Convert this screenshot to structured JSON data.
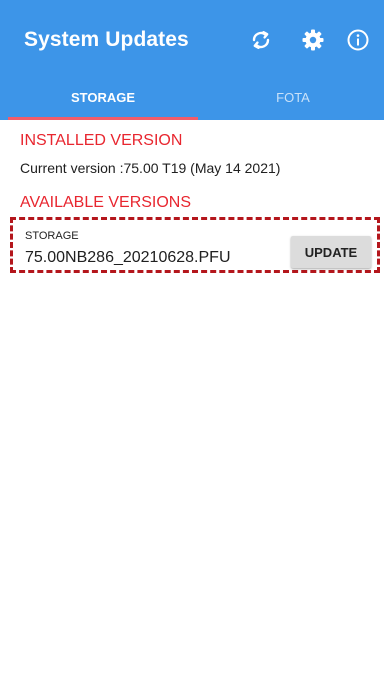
{
  "app": {
    "title": "System Updates",
    "accent_color": "#3d95e8",
    "heading_color": "#e8262f"
  },
  "toolbar": {
    "icons": [
      "sync-icon",
      "gear-icon",
      "info-icon"
    ]
  },
  "tabs": [
    {
      "label": "STORAGE",
      "selected": true
    },
    {
      "label": "FOTA",
      "selected": false
    }
  ],
  "installed": {
    "heading": "INSTALLED VERSION",
    "current_version": "Current version :75.00 T19 (May 14 2021)"
  },
  "available": {
    "heading": "AVAILABLE VERSIONS",
    "items": [
      {
        "source": "STORAGE",
        "filename": "75.00NB286_20210628.PFU",
        "action_label": "UPDATE"
      }
    ]
  }
}
